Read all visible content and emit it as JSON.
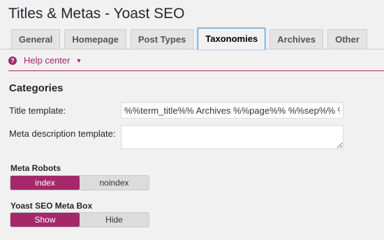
{
  "page": {
    "title": "Titles & Metas - Yoast SEO"
  },
  "tabs": [
    {
      "label": "General",
      "active": false
    },
    {
      "label": "Homepage",
      "active": false
    },
    {
      "label": "Post Types",
      "active": false
    },
    {
      "label": "Taxonomies",
      "active": true
    },
    {
      "label": "Archives",
      "active": false
    },
    {
      "label": "Other",
      "active": false
    }
  ],
  "help": {
    "icon": "question-icon",
    "icon_glyph": "?",
    "label": "Help center",
    "caret_icon": "caret-down-icon",
    "caret_glyph": "▼"
  },
  "section": {
    "title": "Categories"
  },
  "fields": {
    "title_template_label": "Title template:",
    "title_template_value": "%%term_title%% Archives %%page%% %%sep%% %%sitename%%",
    "meta_description_label": "Meta description template:",
    "meta_description_value": ""
  },
  "meta_robots": {
    "title": "Meta Robots",
    "options": [
      "index",
      "noindex"
    ],
    "selected": "index"
  },
  "meta_box": {
    "title": "Yoast SEO Meta Box",
    "options": [
      "Show",
      "Hide"
    ],
    "selected": "Show"
  },
  "colors": {
    "accent": "#a4286a",
    "tab_active_border": "#5b9dd9",
    "background": "#f1f1f1"
  }
}
